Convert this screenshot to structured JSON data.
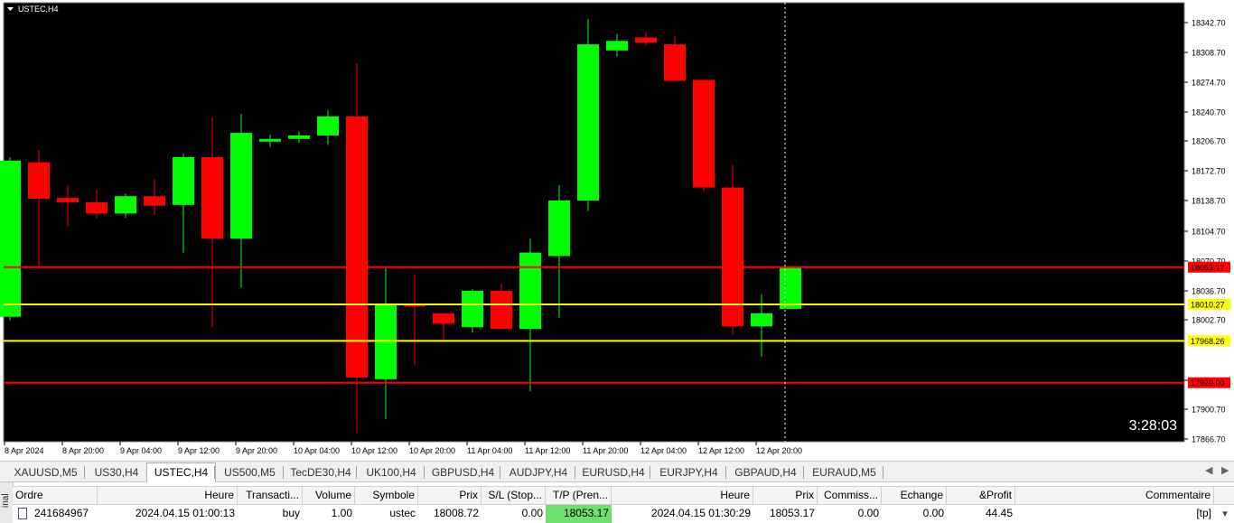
{
  "chart": {
    "symbol_label": "USTEC,H4",
    "countdown": "3:28:03",
    "price_scale": [
      "18342.70",
      "18308.70",
      "18274.70",
      "18240.70",
      "18206.70",
      "18172.70",
      "18138.70",
      "18104.70",
      "18070.70",
      "18036.70",
      "18002.70",
      "17934.70",
      "17900.70",
      "17866.70"
    ],
    "time_labels": [
      "8 Apr 2024",
      "8 Apr 20:00",
      "9 Apr 04:00",
      "9 Apr 12:00",
      "9 Apr 20:00",
      "10 Apr 04:00",
      "10 Apr 12:00",
      "10 Apr 20:00",
      "11 Apr 04:00",
      "11 Apr 12:00",
      "11 Apr 20:00",
      "12 Apr 04:00",
      "12 Apr 12:00",
      "12 Apr 20:00"
    ],
    "price_lines": [
      {
        "label": "18053.17",
        "price": 18053.17,
        "color": "#ff0000",
        "tag_bg": "#ff0000",
        "tag_fg": "#000000"
      },
      {
        "label": "18010.27",
        "price": 18010.27,
        "color": "#ffff00",
        "tag_bg": "#ffff00",
        "tag_fg": "#000000"
      },
      {
        "label": "17968.26",
        "price": 17968.26,
        "color": "#ffff00",
        "tag_bg": "#ffff00",
        "tag_fg": "#000000"
      },
      {
        "label": "17920.00",
        "price": 17920.0,
        "color": "#ff0000",
        "tag_bg": "#ff0000",
        "tag_fg": "#000000"
      }
    ],
    "colors": {
      "background": "#000000",
      "bull": "#00ff00",
      "bear": "#ff0000",
      "grid_text": "#000000",
      "crosshair": "#ffffff"
    }
  },
  "chart_data": {
    "type": "candlestick",
    "title": "USTEC,H4",
    "ylim": [
      17852,
      18358
    ],
    "candles": [
      {
        "o": 17996,
        "h": 18180,
        "l": 17992,
        "c": 18176
      },
      {
        "o": 18174,
        "h": 18188,
        "l": 18054,
        "c": 18132
      },
      {
        "o": 18133,
        "h": 18148,
        "l": 18100,
        "c": 18128
      },
      {
        "o": 18128,
        "h": 18142,
        "l": 18110,
        "c": 18115
      },
      {
        "o": 18115,
        "h": 18138,
        "l": 18110,
        "c": 18135
      },
      {
        "o": 18135,
        "h": 18154,
        "l": 18114,
        "c": 18124
      },
      {
        "o": 18125,
        "h": 18184,
        "l": 18070,
        "c": 18180
      },
      {
        "o": 18180,
        "h": 18226,
        "l": 17984,
        "c": 18086
      },
      {
        "o": 18086,
        "h": 18230,
        "l": 18030,
        "c": 18208
      },
      {
        "o": 18199,
        "h": 18206,
        "l": 18192,
        "c": 18201
      },
      {
        "o": 18201,
        "h": 18210,
        "l": 18196,
        "c": 18205
      },
      {
        "o": 18205,
        "h": 18234,
        "l": 18194,
        "c": 18227
      },
      {
        "o": 18227,
        "h": 18288,
        "l": 17862,
        "c": 17926
      },
      {
        "o": 17924,
        "h": 18052,
        "l": 17878,
        "c": 18011
      },
      {
        "o": 18011,
        "h": 18045,
        "l": 17940,
        "c": 18010
      },
      {
        "o": 18000,
        "h": 18000,
        "l": 17970,
        "c": 17988
      },
      {
        "o": 17984,
        "h": 18028,
        "l": 17978,
        "c": 18026
      },
      {
        "o": 18026,
        "h": 18034,
        "l": 17982,
        "c": 17982
      },
      {
        "o": 17982,
        "h": 18086,
        "l": 17910,
        "c": 18070
      },
      {
        "o": 18066,
        "h": 18148,
        "l": 17995,
        "c": 18130
      },
      {
        "o": 18130,
        "h": 18339,
        "l": 18118,
        "c": 18310
      },
      {
        "o": 18303,
        "h": 18322,
        "l": 18296,
        "c": 18314
      },
      {
        "o": 18318,
        "h": 18324,
        "l": 18308,
        "c": 18312
      },
      {
        "o": 18310,
        "h": 18320,
        "l": 18268,
        "c": 18268
      },
      {
        "o": 18269,
        "h": 18268,
        "l": 18140,
        "c": 18145
      },
      {
        "o": 18145,
        "h": 18171,
        "l": 17975,
        "c": 17985
      },
      {
        "o": 17985,
        "h": 18022,
        "l": 17950,
        "c": 18000
      },
      {
        "o": 18005,
        "h": 18053,
        "l": 18005,
        "c": 18053
      }
    ]
  },
  "tabs": [
    "XAUUSD,M5",
    "US30,H4",
    "USTEC,H4",
    "US500,M5",
    "TecDE30,H4",
    "UK100,H4",
    "GBPUSD,H4",
    "AUDJPY,H4",
    "EURUSD,H4",
    "EURJPY,H4",
    "GBPAUD,H4",
    "EURAUD,M5"
  ],
  "active_tab": "USTEC,H4",
  "terminal": {
    "side_label": "inal",
    "columns": [
      "Ordre",
      "Heure",
      "Transacti...",
      "Volume",
      "Symbole",
      "Prix",
      "S/L (Stop...",
      "T/P (Pren...",
      "Heure",
      "Prix",
      "Commiss...",
      "Echange",
      "&Profit",
      "Commentaire"
    ],
    "row": [
      "241684967",
      "2024.04.15 01:00:13",
      "buy",
      "1.00",
      "ustec",
      "18008.72",
      "0.00",
      "18053.17",
      "2024.04.15 01:30:29",
      "18053.17",
      "0.00",
      "0.00",
      "44.45",
      "[tp]"
    ]
  }
}
